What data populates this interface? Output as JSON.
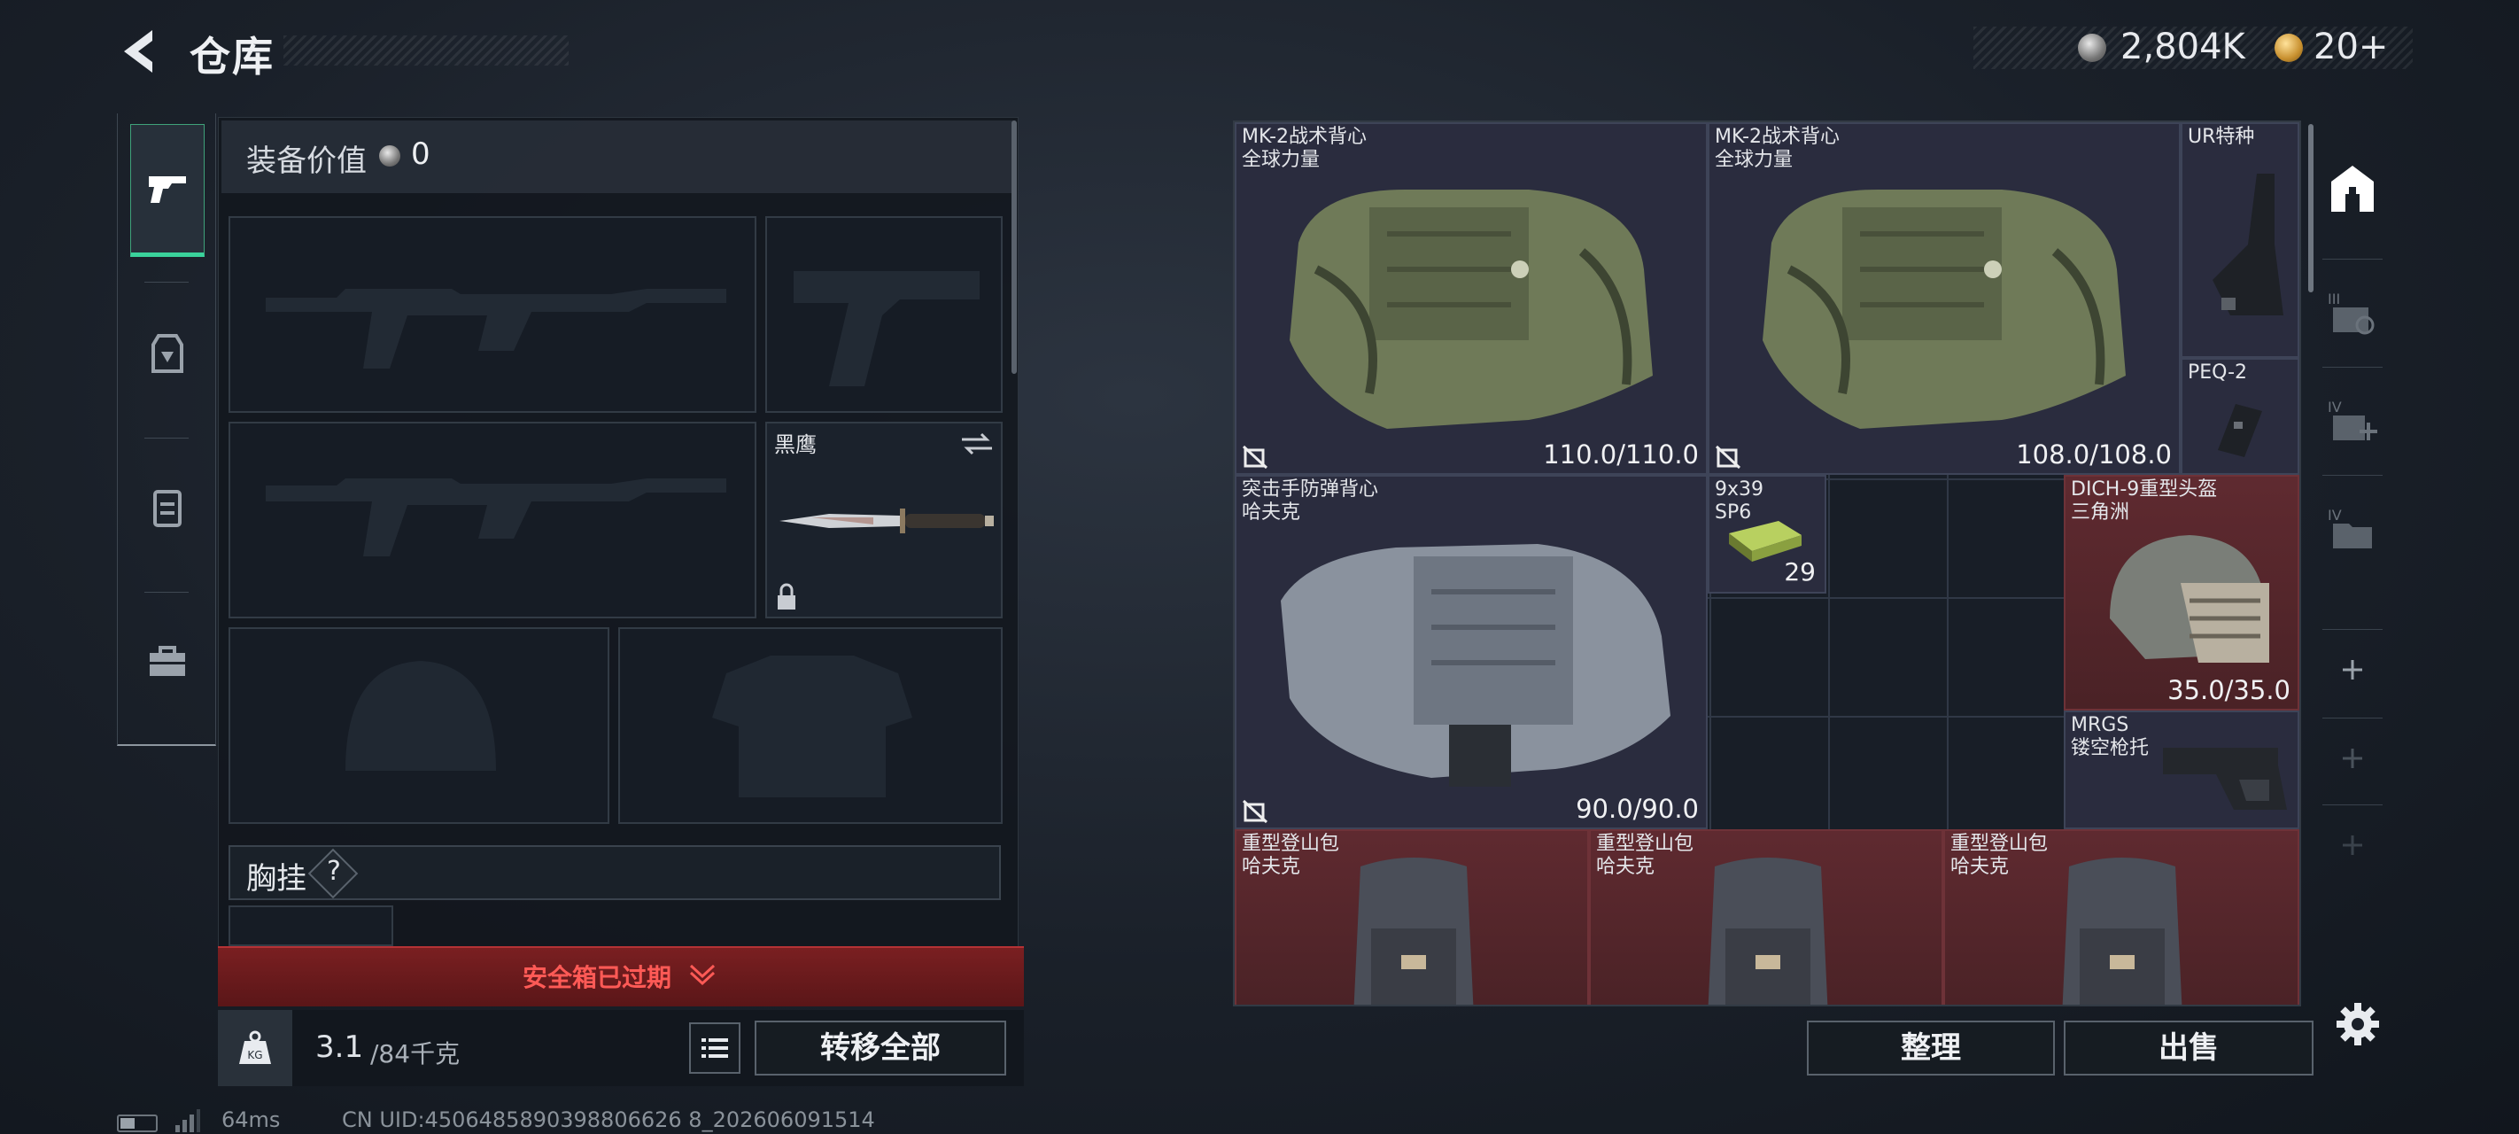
{
  "header": {
    "title": "仓库",
    "money": "2,804K",
    "tickets": "20+"
  },
  "loadout": {
    "equip_value_label": "装备价值",
    "equip_value": "0",
    "melee_name": "黑鹰",
    "chest_rig_label": "胸挂",
    "chest_help": "?",
    "safe_box_status": "安全箱已过期",
    "weight_current": "3.1",
    "weight_max": "/84千克",
    "transfer_all": "转移全部"
  },
  "stash": {
    "items": [
      {
        "name": "MK-2战术背心\n全球力量",
        "durability": "110.0/110.0"
      },
      {
        "name": "MK-2战术背心\n全球力量",
        "durability": "108.0/108.0"
      },
      {
        "name": "UR特种"
      },
      {
        "name": "PEQ-2"
      },
      {
        "name": "突击手防弹背心\n哈夫克",
        "durability": "90.0/90.0"
      },
      {
        "name": "9x39\nSP6",
        "count": "29"
      },
      {
        "name": "DICH-9重型头盔\n三角洲",
        "durability": "35.0/35.0"
      },
      {
        "name": "MRGS\n镂空枪托"
      },
      {
        "name": "重型登山包\n哈夫克"
      },
      {
        "name": "重型登山包\n哈夫克"
      },
      {
        "name": "重型登山包\n哈夫克"
      }
    ],
    "sort": "整理",
    "sell": "出售"
  },
  "status": {
    "ping": "64ms",
    "uid": "CN UID:4506485890398806626 8_202606091514"
  },
  "colors": {
    "accent_green": "#3ad29b",
    "danger_red": "#ff5a56",
    "item_bg": "#2a2c3e",
    "item_red_bg": "#5f2a30"
  },
  "icons": [
    "back-arrow-icon",
    "silver-coin-icon",
    "gold-ticket-icon",
    "pistol-icon",
    "backpack-armor-icon",
    "vest-icon",
    "toolbox-icon",
    "swap-icon",
    "lock-icon",
    "kg-weight-icon",
    "list-icon",
    "no-trade-icon",
    "stash-home-icon",
    "stash-tab-3-icon",
    "stash-tab-4-medical-icon",
    "stash-tab-4-folder-icon",
    "add-tab-icon",
    "settings-gear-icon"
  ]
}
